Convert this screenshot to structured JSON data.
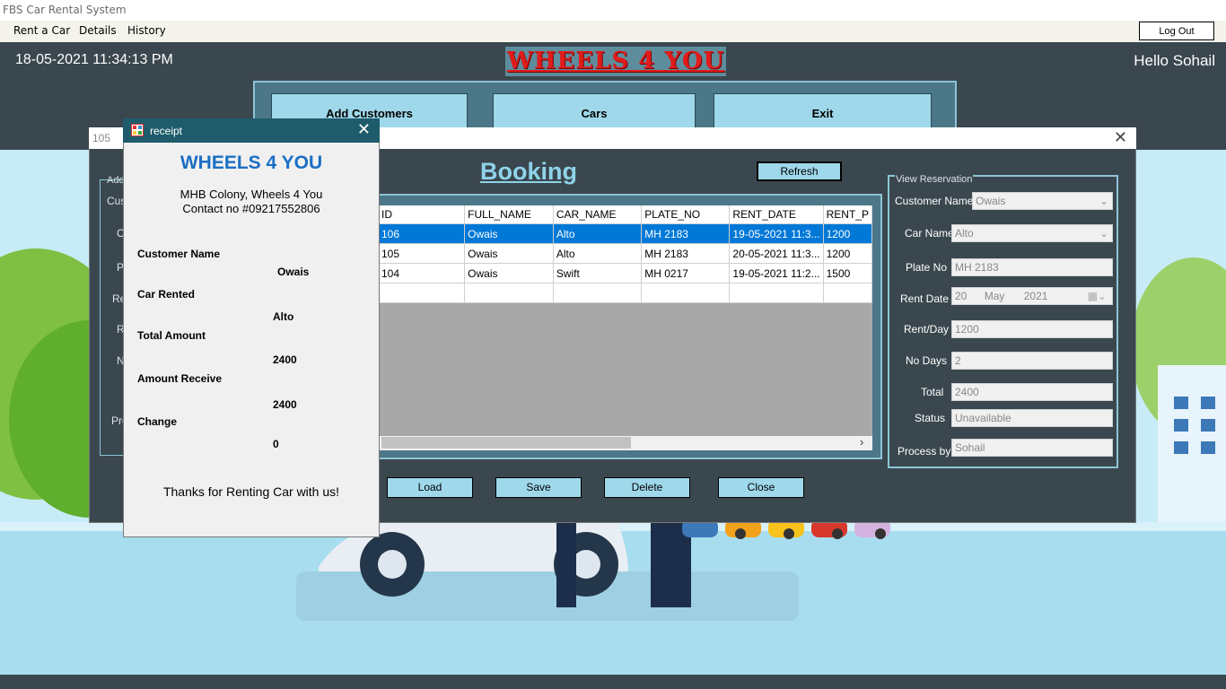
{
  "app": {
    "title": "FBS Car Rental System"
  },
  "menu": {
    "items": [
      "Rent a Car",
      "Details",
      "History"
    ],
    "logout": "Log Out"
  },
  "header": {
    "datetime": "18-05-2021 11:34:13 PM",
    "logo": "WHEELS 4 YOU",
    "greeting": "Hello Sohail",
    "nav": [
      "Add Customers",
      "Cars",
      "Exit"
    ]
  },
  "booking": {
    "window_title": "105",
    "heading": "Booking",
    "refresh": "Refresh",
    "columns": [
      "ID",
      "FULL_NAME",
      "CAR_NAME",
      "PLATE_NO",
      "RENT_DATE",
      "RENT_P"
    ],
    "rows": [
      [
        "106",
        "Owais",
        "Alto",
        "MH 2183",
        "19-05-2021 11:3...",
        "1200"
      ],
      [
        "105",
        "Owais",
        "Alto",
        "MH 2183",
        "20-05-2021 11:3...",
        "1200"
      ],
      [
        "104",
        "Owais",
        "Swift",
        "MH 0217",
        "19-05-2021 11:2...",
        "1500"
      ]
    ],
    "buttons": {
      "load": "Load",
      "save": "Save",
      "delete": "Delete",
      "close": "Close"
    },
    "left_labels": [
      "Add",
      "Cus",
      "C",
      "P",
      "Re",
      "R",
      "N",
      "Pro"
    ]
  },
  "view_reservation": {
    "title": "View Reservation",
    "customer_name_label": "Customer Name",
    "customer_name": "Owais",
    "car_name_label": "Car Name",
    "car_name": "Alto",
    "plate_no_label": "Plate No",
    "plate_no": "MH 2183",
    "rent_date_label": "Rent Date",
    "rent_day": "20",
    "rent_month": "May",
    "rent_year": "2021",
    "rent_per_day_label": "Rent/Day",
    "rent_per_day": "1200",
    "no_days_label": "No Days",
    "no_days": "2",
    "total_label": "Total",
    "total": "2400",
    "status_label": "Status",
    "status": "Unavailable",
    "process_by_label": "Process by",
    "process_by": "Sohail"
  },
  "receipt": {
    "window_title": "receipt",
    "brand": "WHEELS 4 YOU",
    "address": "MHB Colony, Wheels 4 You",
    "contact": "Contact no #09217552806",
    "customer_name_label": "Customer Name",
    "customer_name": "Owais",
    "car_rented_label": "Car Rented",
    "car_rented": "Alto",
    "total_amount_label": "Total Amount",
    "total_amount": "2400",
    "amount_receive_label": "Amount Receive",
    "amount_receive": "2400",
    "change_label": "Change",
    "change": "0",
    "footer": "Thanks for Renting Car with us!"
  },
  "colors": {
    "accent": "#9fd8ea",
    "panel": "#3a474e",
    "selection": "#0078d7",
    "logo": "#e21b1b",
    "receipt_brand": "#1a6fc4"
  }
}
